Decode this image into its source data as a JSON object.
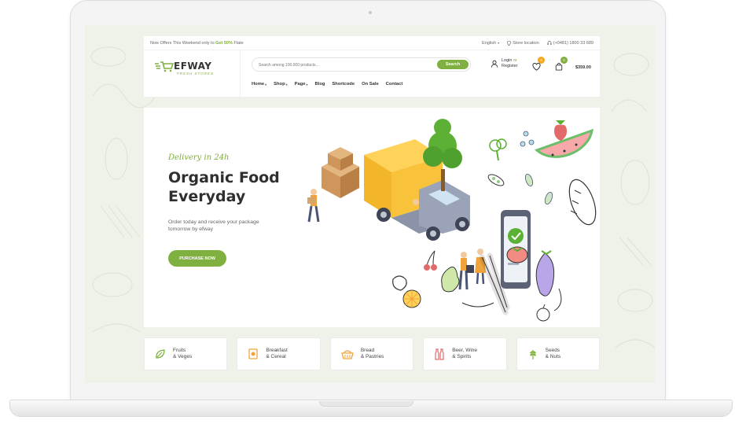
{
  "topbar": {
    "offer_prefix": "Now Offers This Weekend only to ",
    "offer_highlight": "Get 50%",
    "offer_suffix": " Flate",
    "language": "English",
    "store_location": "Store location",
    "phone": "(+0481) 1800 33 689"
  },
  "header": {
    "logo_text": "EFWAY",
    "logo_sub": "FRESH STORES",
    "search": {
      "placeholder": "Search among 100.000 products...",
      "button_label": "Search"
    },
    "nav": [
      {
        "label": "Home",
        "dropdown": true
      },
      {
        "label": "Shop",
        "dropdown": true
      },
      {
        "label": "Page",
        "dropdown": true
      },
      {
        "label": "Blog",
        "dropdown": false
      },
      {
        "label": "Shortcode",
        "dropdown": false
      },
      {
        "label": "On Sale",
        "dropdown": false
      },
      {
        "label": "Contact",
        "dropdown": false
      }
    ],
    "account": {
      "login": "Login",
      "or": "or",
      "register": "Register"
    },
    "wishlist_count": "0",
    "cart_count": "0",
    "cart_total": "$359.00"
  },
  "hero": {
    "tagline": "Delivery in 24h",
    "title_line1": "Organic Food",
    "title_line2": "Everyday",
    "description_line1": "Order today and receive your package",
    "description_line2": "tomorrow by efway",
    "button_label": "PURCHASE NOW"
  },
  "categories": [
    {
      "line1": "Fruits",
      "line2": "& Veges",
      "icon": "leaf-icon"
    },
    {
      "line1": "Breakfast",
      "line2": "& Cereal",
      "icon": "cereal-box-icon"
    },
    {
      "line1": "Bread",
      "line2": "& Pastries",
      "icon": "bread-basket-icon"
    },
    {
      "line1": "Beer, Wine",
      "line2": "& Spirits",
      "icon": "bottles-icon"
    },
    {
      "line1": "Seeds",
      "line2": "& Nuts",
      "icon": "wheat-icon"
    }
  ],
  "colors": {
    "accent": "#80b140",
    "badge_orange": "#f5a623",
    "badge_green": "#80b140",
    "category_icon_red": "#e26a6a",
    "category_icon_orange": "#f0a33a"
  }
}
